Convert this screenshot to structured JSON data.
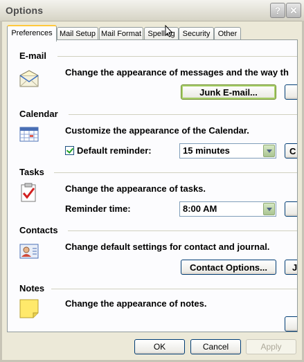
{
  "window": {
    "title": "Options",
    "help_label": "?",
    "close_label": "✕"
  },
  "tabs": [
    {
      "label": "Preferences",
      "active": true
    },
    {
      "label": "Mail Setup"
    },
    {
      "label": "Mail Format"
    },
    {
      "label": "Spelling"
    },
    {
      "label": "Security"
    },
    {
      "label": "Other"
    }
  ],
  "sections": {
    "email": {
      "title": "E-mail",
      "description": "Change the appearance of messages and the way th",
      "icon": "envelope-icon",
      "junk_button": "Junk E-mail..."
    },
    "calendar": {
      "title": "Calendar",
      "description": "Customize the appearance of the Calendar.",
      "icon": "calendar-icon",
      "reminder_label": "Default reminder:",
      "reminder_checked": true,
      "reminder_value": "15 minutes",
      "partial_button": "C"
    },
    "tasks": {
      "title": "Tasks",
      "description": "Change the appearance of tasks.",
      "icon": "task-clipboard-icon",
      "reminder_time_label": "Reminder time:",
      "reminder_time_value": "8:00 AM"
    },
    "contacts": {
      "title": "Contacts",
      "description": "Change default settings for contact and journal.",
      "icon": "contact-card-icon",
      "options_button": "Contact Options...",
      "partial_button": "J"
    },
    "notes": {
      "title": "Notes",
      "description": "Change the appearance of notes.",
      "icon": "sticky-note-icon"
    }
  },
  "footer": {
    "ok": "OK",
    "cancel": "Cancel",
    "apply": "Apply"
  },
  "colors": {
    "dialog_bg": "#ece9d8",
    "panel_bg": "#fcfcfe",
    "tab_accent": "#ffc83c",
    "button_border": "#003c74"
  }
}
